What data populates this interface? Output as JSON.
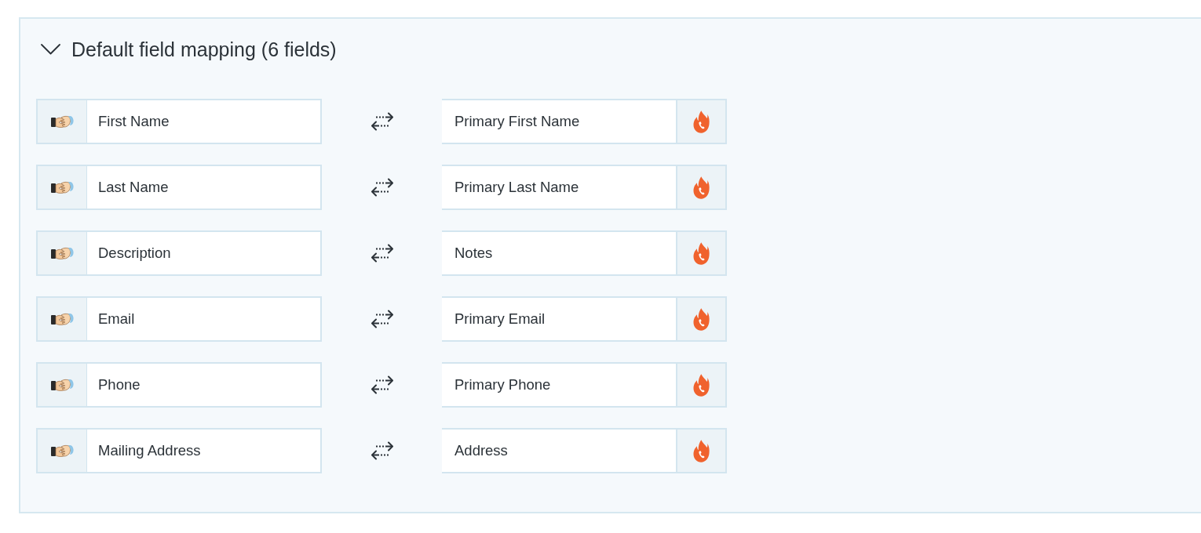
{
  "panel": {
    "title": "Default field mapping (6 fields)",
    "expanded": true
  },
  "mappings": [
    {
      "source": "First Name",
      "target": "Primary First Name"
    },
    {
      "source": "Last Name",
      "target": "Primary Last Name"
    },
    {
      "source": "Description",
      "target": "Notes"
    },
    {
      "source": "Email",
      "target": "Primary Email"
    },
    {
      "source": "Phone",
      "target": "Primary Phone"
    },
    {
      "source": "Mailing Address",
      "target": "Address"
    }
  ]
}
